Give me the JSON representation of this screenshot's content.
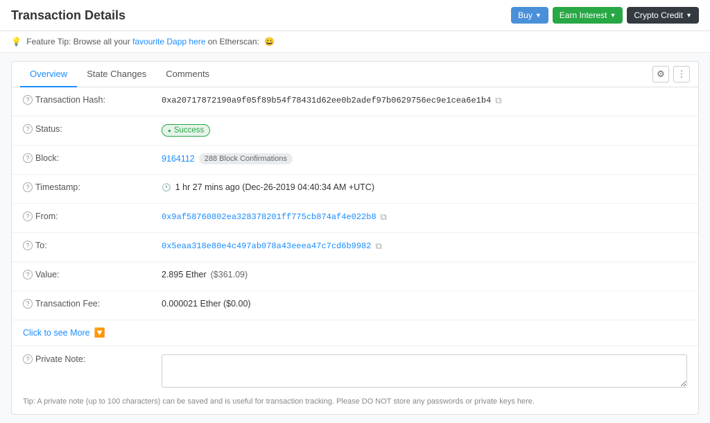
{
  "header": {
    "title": "Transaction Details",
    "buttons": [
      {
        "label": "Buy",
        "style": "blue"
      },
      {
        "label": "Earn Interest",
        "style": "green"
      },
      {
        "label": "Crypto Credit",
        "style": "dark"
      }
    ]
  },
  "feature_tip": {
    "prefix": "Feature Tip: Browse all your ",
    "link_text": "favourite Dapp here",
    "suffix": " on Etherscan:",
    "emoji": "😀"
  },
  "tabs": {
    "items": [
      {
        "label": "Overview",
        "active": true
      },
      {
        "label": "State Changes",
        "active": false
      },
      {
        "label": "Comments",
        "active": false
      }
    ]
  },
  "details": {
    "transaction_hash": {
      "label": "Transaction Hash:",
      "value": "0xa20717872190a9f05f89b54f78431d62ee0b2adef97b0629756ec9e1cea6e1b4"
    },
    "status": {
      "label": "Status:",
      "value": "Success"
    },
    "block": {
      "label": "Block:",
      "number": "9164112",
      "confirmations": "288 Block Confirmations"
    },
    "timestamp": {
      "label": "Timestamp:",
      "value": "1 hr 27 mins ago (Dec-26-2019 04:40:34 AM +UTC)"
    },
    "from": {
      "label": "From:",
      "value": "0x9af58760802ea328378201ff775cb874af4e022b8"
    },
    "to": {
      "label": "To:",
      "value": "0x5eaa318e80e4c497ab078a43eeea47c7cd6b9982"
    },
    "value": {
      "label": "Value:",
      "ether": "2.895 Ether",
      "usd": "($361.09)"
    },
    "fee": {
      "label": "Transaction Fee:",
      "value": "0.000021 Ether ($0.00)"
    }
  },
  "click_more": "Click to see More",
  "private_note": {
    "label": "Private Note:",
    "placeholder": "",
    "tip": "Tip: A private note (up to 100 characters) can be saved and is useful for transaction tracking. Please DO NOT store any passwords or private keys here."
  }
}
